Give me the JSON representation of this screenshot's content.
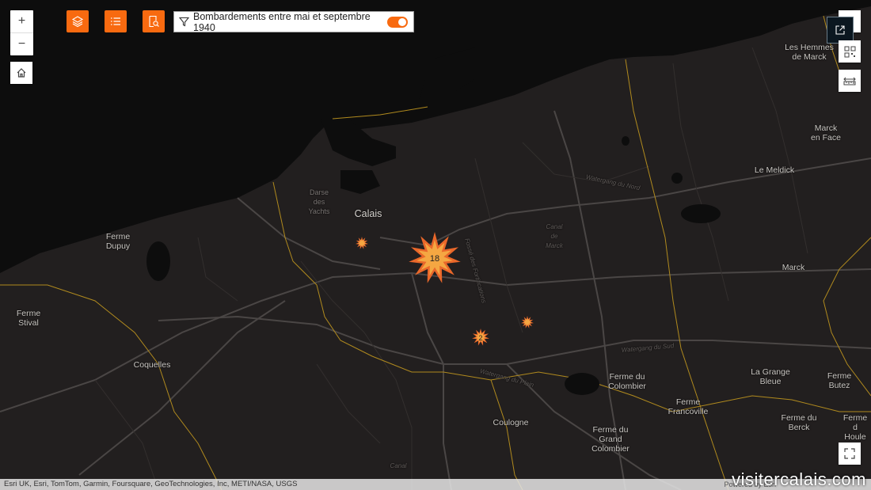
{
  "controls": {
    "zoom_in": "+",
    "zoom_out": "−",
    "home_icon": "home-icon",
    "layers_icon": "layers-icon",
    "legend_icon": "list-icon",
    "search_icon": "search-doc-icon",
    "share_icon": "external-link-icon",
    "qr_icon": "qr-icon",
    "measure_icon": "ruler-icon",
    "fullscreen_icon": "fullscreen-icon"
  },
  "filter": {
    "label": "Bombardements entre mai et septembre 1940",
    "enabled": true
  },
  "clusters": [
    {
      "count": "18",
      "color": "#f5a742"
    },
    {
      "count": "2",
      "color": "#f5a742"
    },
    {
      "count": "",
      "color": "#f5a742"
    },
    {
      "count": "",
      "color": "#f5a742"
    }
  ],
  "places": {
    "calais": "Calais",
    "darse": "Darse\ndes\nYachts",
    "ferme_dupuy": "Ferme\nDupuy",
    "ferme_stival": "Ferme\nStival",
    "coquelles": "Coquelles",
    "coulogne": "Coulogne",
    "ferme_colombier": "Ferme du\nColombier",
    "ferme_grand_colombier": "Ferme du\nGrand\nColombier",
    "ferme_francoville": "Ferme\nFrancoville",
    "marck": "Marck",
    "marck_en_face": "Marck\nen Face",
    "le_meldick": "Le Meldick",
    "les_hemmes": "Les Hemmes\nde Marck",
    "la_grange_bleue": "La Grange\nBleue",
    "ferme_butez": "Ferme\nButez",
    "ferme_berck": "Ferme du\nBerck",
    "ferme_houle": "Ferme d\nHoule",
    "canal_marck": "Canal\nde\nMarck",
    "watergang_nord": "Watergang du Nord",
    "watergang_sud": "Watergang du Sud",
    "watergang_plain": "Watergang du Plain",
    "fosse": "Fossé des Fortifications",
    "canal_bottom": "Canal"
  },
  "attribution": "Esri UK, Esri, TomTom, Garmin, Foursquare, GeoTechnologies, Inc, METI/NASA, USGS",
  "powered": "Powered by Esri",
  "watermark": "visitercalais.com",
  "colors": {
    "sea": "#0d0d0d",
    "land": "#221f1f",
    "boundary": "#b08a1e",
    "accent": "#f86a10"
  }
}
